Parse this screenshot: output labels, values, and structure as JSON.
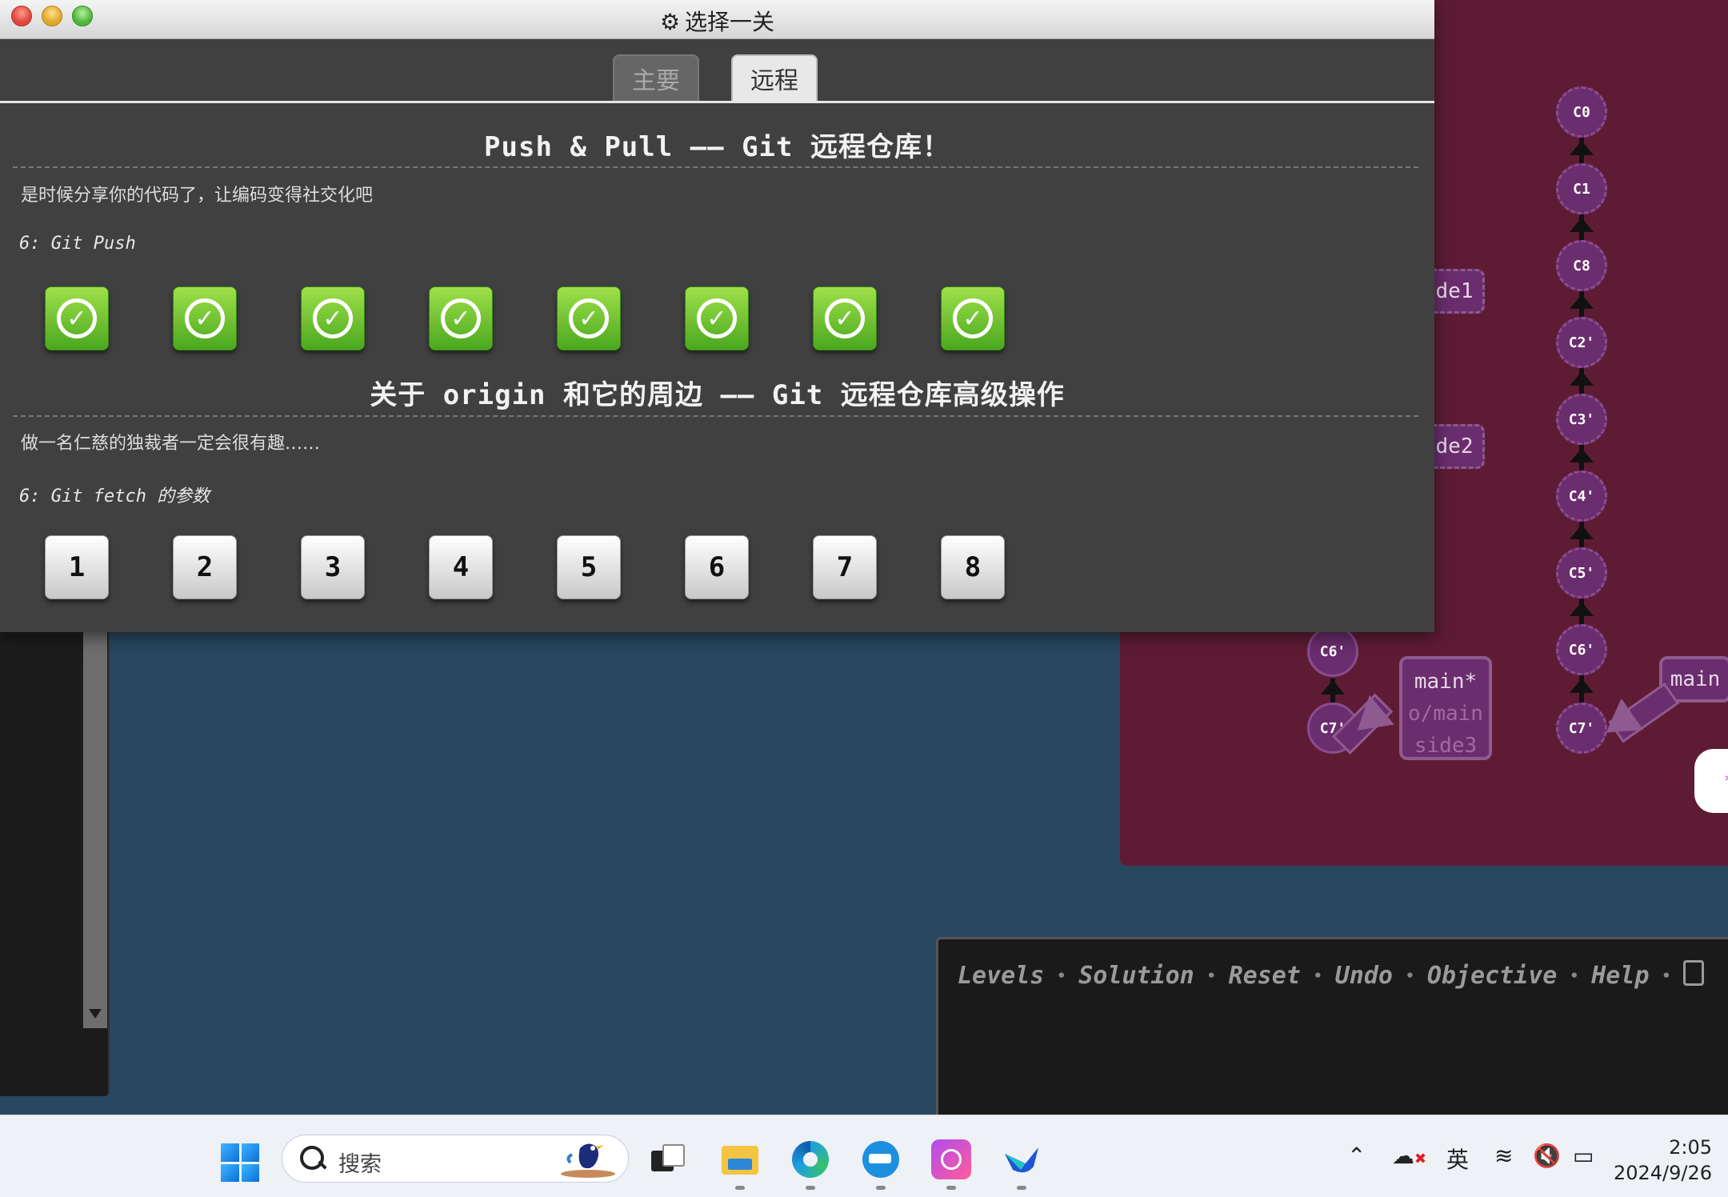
{
  "window": {
    "title": "选择一关",
    "title_icon": "gear-icon"
  },
  "tabs": [
    {
      "label": "主要",
      "active": false
    },
    {
      "label": "远程",
      "active": true
    }
  ],
  "sections": [
    {
      "title": "Push & Pull —— Git 远程仓库！",
      "description": "是时候分享你的代码了，让编码变得社交化吧",
      "level_label": "6: Git Push",
      "levels": [
        "1",
        "2",
        "3",
        "4",
        "5",
        "6",
        "7",
        "8"
      ],
      "completed": [
        true,
        true,
        true,
        true,
        true,
        true,
        true,
        true
      ]
    },
    {
      "title": "关于 origin 和它的周边 —— Git 远程仓库高级操作",
      "description": "做一名仁慈的独裁者一定会很有趣……",
      "level_label": "6: Git fetch 的参数",
      "levels": [
        "1",
        "2",
        "3",
        "4",
        "5",
        "6",
        "7",
        "8"
      ],
      "completed": [
        false,
        false,
        false,
        false,
        false,
        false,
        false,
        false
      ]
    }
  ],
  "visualization": {
    "right_column_commits": [
      "C0",
      "C1",
      "C8",
      "C2'",
      "C3'",
      "C4'",
      "C5'",
      "C6'",
      "C7'"
    ],
    "left_column_commits": [
      "C6'",
      "C7'"
    ],
    "branch_labels_partial": [
      "de1",
      "de2"
    ],
    "left_branch_box": [
      "main*",
      "o/main",
      "side3"
    ],
    "right_branch_box": "main",
    "colors": {
      "background": "#5e1c34",
      "node": "#6a2d6e"
    }
  },
  "command_bar": {
    "links": [
      "Levels",
      "Solution",
      "Reset",
      "Undo",
      "Objective",
      "Help"
    ]
  },
  "taskbar": {
    "search_placeholder": "搜索",
    "ime": "英",
    "time": "2:05",
    "date": "2024/9/26"
  }
}
